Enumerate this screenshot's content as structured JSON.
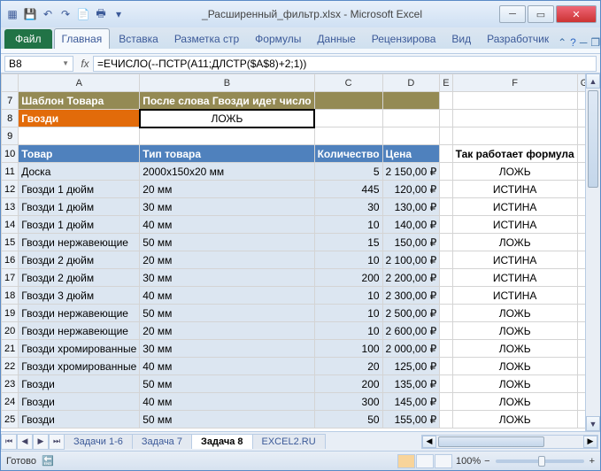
{
  "window": {
    "title": "_Расширенный_фильтр.xlsx - Microsoft Excel"
  },
  "ribbon": {
    "file": "Файл",
    "tabs": [
      "Главная",
      "Вставка",
      "Разметка стр",
      "Формулы",
      "Данные",
      "Рецензирова",
      "Вид",
      "Разработчик"
    ]
  },
  "namebox": "B8",
  "formula": "=ЕЧИСЛО(--ПСТР(A11;ДЛСТР($A$8)+2;1))",
  "cols": [
    "A",
    "B",
    "C",
    "D",
    "E",
    "F",
    "G"
  ],
  "first_row": 7,
  "r7": {
    "A": "Шаблон Товара",
    "B": "После слова Гвозди идет число"
  },
  "r8": {
    "A": "Гвозди",
    "B": "ЛОЖЬ"
  },
  "r10": {
    "A": "Товар",
    "B": "Тип товара",
    "C": "Количество",
    "D": "Цена",
    "F": "Так работает формула"
  },
  "rows": [
    {
      "n": 11,
      "A": "Доска",
      "B": "2000х150х20 мм",
      "C": "5",
      "D": "2 150,00 ₽",
      "F": "ЛОЖЬ"
    },
    {
      "n": 12,
      "A": "Гвозди 1 дюйм",
      "B": "20 мм",
      "C": "445",
      "D": "120,00 ₽",
      "F": "ИСТИНА"
    },
    {
      "n": 13,
      "A": "Гвозди 1 дюйм",
      "B": "30 мм",
      "C": "30",
      "D": "130,00 ₽",
      "F": "ИСТИНА"
    },
    {
      "n": 14,
      "A": "Гвозди 1 дюйм",
      "B": "40 мм",
      "C": "10",
      "D": "140,00 ₽",
      "F": "ИСТИНА"
    },
    {
      "n": 15,
      "A": "Гвозди нержавеющие",
      "B": "50 мм",
      "C": "15",
      "D": "150,00 ₽",
      "F": "ЛОЖЬ"
    },
    {
      "n": 16,
      "A": "Гвозди 2 дюйм",
      "B": "20 мм",
      "C": "10",
      "D": "2 100,00 ₽",
      "F": "ИСТИНА"
    },
    {
      "n": 17,
      "A": "Гвозди 2 дюйм",
      "B": "30 мм",
      "C": "200",
      "D": "2 200,00 ₽",
      "F": "ИСТИНА"
    },
    {
      "n": 18,
      "A": "Гвозди 3 дюйм",
      "B": "40 мм",
      "C": "10",
      "D": "2 300,00 ₽",
      "F": "ИСТИНА"
    },
    {
      "n": 19,
      "A": "Гвозди нержавеющие",
      "B": "50 мм",
      "C": "10",
      "D": "2 500,00 ₽",
      "F": "ЛОЖЬ"
    },
    {
      "n": 20,
      "A": "Гвозди нержавеющие",
      "B": "20 мм",
      "C": "10",
      "D": "2 600,00 ₽",
      "F": "ЛОЖЬ"
    },
    {
      "n": 21,
      "A": "Гвозди хромированные",
      "B": "30 мм",
      "C": "100",
      "D": "2 000,00 ₽",
      "F": "ЛОЖЬ"
    },
    {
      "n": 22,
      "A": "Гвозди хромированные",
      "B": "40 мм",
      "C": "20",
      "D": "125,00 ₽",
      "F": "ЛОЖЬ"
    },
    {
      "n": 23,
      "A": "Гвозди",
      "B": "50 мм",
      "C": "200",
      "D": "135,00 ₽",
      "F": "ЛОЖЬ"
    },
    {
      "n": 24,
      "A": "Гвозди",
      "B": "40 мм",
      "C": "300",
      "D": "145,00 ₽",
      "F": "ЛОЖЬ"
    },
    {
      "n": 25,
      "A": "Гвозди",
      "B": "50 мм",
      "C": "50",
      "D": "155,00 ₽",
      "F": "ЛОЖЬ"
    }
  ],
  "sheet_tabs": [
    "Задачи 1-6",
    "Задача 7",
    "Задача 8",
    "EXCEL2.RU"
  ],
  "active_sheet": 2,
  "status": {
    "ready": "Готово",
    "zoom": "100%"
  }
}
